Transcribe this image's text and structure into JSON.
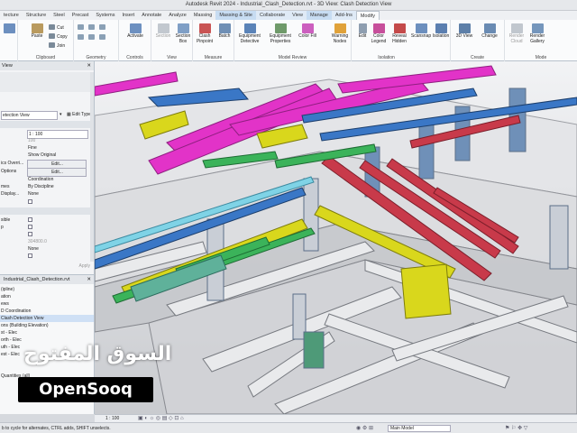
{
  "window": {
    "title": "Autodesk Revit 2024 - Industrial_Clash_Detection.rvt - 3D View: Clash Detection View"
  },
  "ribbon_tabs": [
    "tecture",
    "Structure",
    "Steel",
    "Precast",
    "Systems",
    "Insert",
    "Annotate",
    "Analyze",
    "Massing",
    "Massing & Site",
    "Collaborate",
    "View",
    "Manage",
    "Add-Ins",
    "Modify"
  ],
  "ribbon_groups": {
    "clipboard": "Clipboard",
    "geometry": "Geometry",
    "controls": "Controls",
    "view": "View",
    "measure": "Measure",
    "model_review": "Model Review",
    "isolation": "Isolation",
    "create": "Create",
    "mode": "Mode"
  },
  "ribbon_buttons": {
    "paste": "Paste",
    "cut": "Cut",
    "copy": "Copy",
    "join": "Join",
    "activate": "Activate",
    "section": "Section",
    "section_box": "Section Box",
    "clash_pinpoint": "Clash Pinpoint",
    "batch": "Batch",
    "equipment_detective": "Equipment Detective",
    "equipment_properties": "Equipment Properties",
    "color_fill": "Color Fill",
    "warning_nodes": "Warning Nodes",
    "edit": "Edit",
    "color_legend": "Color Legend",
    "reveal_hidden": "Reveal Hidden",
    "scansnap_isolation": "Scansnap",
    "isolation": "Isolation",
    "view_3d": "3D View",
    "change": "Change",
    "render_cloud": "Render Cloud",
    "render_gallery": "Render Gallery"
  },
  "properties": {
    "title": "View",
    "type_selector": "etection View",
    "edit_type": "Edit Type",
    "rows": [
      {
        "k": "",
        "v": "1 : 100",
        "style": "box"
      },
      {
        "k": "",
        "v": "100",
        "style": "dim"
      },
      {
        "k": "",
        "v": "Fine",
        "style": "plain"
      },
      {
        "k": "",
        "v": "Show Original",
        "style": "plain"
      },
      {
        "k": "ics Overri...",
        "v": "Edit...",
        "style": "btn"
      },
      {
        "k": "Options",
        "v": "Edit...",
        "style": "btn"
      },
      {
        "k": "",
        "v": "Coordination",
        "style": "plain"
      },
      {
        "k": "mes",
        "v": "By Discipline",
        "style": "plain"
      },
      {
        "k": "Display...",
        "v": "None",
        "style": "plain"
      }
    ],
    "rows2": [
      {
        "k": "sible",
        "v": ""
      },
      {
        "k": "p",
        "v": ""
      },
      {
        "k": "",
        "v": ""
      },
      {
        "k": "",
        "v": "304800.0"
      },
      {
        "k": "",
        "v": "None"
      }
    ],
    "apply": "Apply"
  },
  "browser": {
    "title": "Industrial_Clash_Detection.rvt",
    "items": [
      "(ipline)",
      "ation",
      "ews",
      "D Coordination",
      "Clash Detection View",
      "ons (Building Elevation)",
      "st - Elec",
      "orth - Elec",
      "uth - Elec",
      "est - Elec",
      "",
      "",
      "Quantities (all)",
      ""
    ],
    "selected_index": 4
  },
  "viewbar": {
    "scale": "1 : 100"
  },
  "statusbar": {
    "hint": "b to cycle for alternates, CTRL adds, SHIFT unselects.",
    "model": "Main Model"
  },
  "watermark": {
    "arabic": "السوق المفتوح",
    "brand": "OpenSooq"
  },
  "colors": {
    "magenta": "#e233c8",
    "steel_blue": "#3a77c6",
    "yellow": "#d9d71c",
    "green": "#3bb35a",
    "red": "#c83a4a",
    "slab": "#d9dadd"
  }
}
